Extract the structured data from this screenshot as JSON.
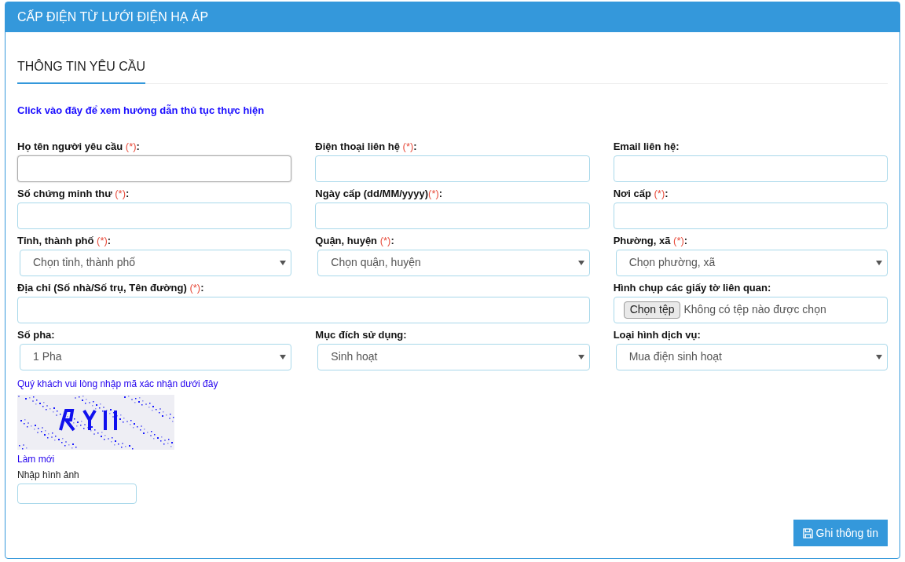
{
  "panel": {
    "title": "CẤP ĐIỆN TỪ LƯỚI ĐIỆN HẠ ÁP"
  },
  "section": {
    "title": "THÔNG TIN YÊU CẦU"
  },
  "guide_link": "Click vào đây để xem hướng dẫn thủ tục thực hiện",
  "fields": [
    {
      "kind": "text",
      "label": "Họ tên người yêu cầu ",
      "required": "(*)",
      "suffix": ":",
      "focused": true
    },
    {
      "kind": "text",
      "label": "Điện thoại liên hệ ",
      "required": "(*)",
      "suffix": ":",
      "focused": false
    },
    {
      "kind": "text",
      "label": "Email liên hệ:",
      "focused": false
    },
    {
      "kind": "text",
      "label": "Số chứng minh thư ",
      "required": "(*)",
      "suffix": ":",
      "focused": false
    },
    {
      "kind": "text",
      "label": "Ngày cấp (dd/MM/yyyy)",
      "required": "(*)",
      "suffix": ":",
      "focused": false
    },
    {
      "kind": "text",
      "label": "Nơi cấp ",
      "required": "(*)",
      "suffix": ":",
      "focused": false
    },
    {
      "kind": "select",
      "label": "Tỉnh, thành phố ",
      "required": "(*)",
      "suffix": ":",
      "value": "Chọn tỉnh, thành phố"
    },
    {
      "kind": "select",
      "label": "Quận, huyện ",
      "required": "(*)",
      "suffix": ":",
      "value": "Chọn quận, huyện"
    },
    {
      "kind": "select",
      "label": "Phường, xã ",
      "required": "(*)",
      "suffix": ":",
      "value": "Chọn phường, xã"
    },
    {
      "kind": "wide_text",
      "label": "Địa chỉ (Số nhà/Số trụ, Tên đường) ",
      "required": "(*)",
      "suffix": ":",
      "focused": false
    },
    {
      "kind": "file",
      "label": "Hình chụp các giấy tờ liên quan:",
      "button": "Chọn tệp",
      "status": "Không có tệp nào được chọn"
    },
    {
      "kind": "select",
      "label": "Số pha:",
      "value": "1 Pha"
    },
    {
      "kind": "select",
      "label": "Mục đích sử dụng:",
      "value": "Sinh hoạt"
    },
    {
      "kind": "select",
      "label": "Loại hình dịch vụ:",
      "value": "Mua điện sinh hoạt"
    }
  ],
  "captcha": {
    "prompt": "Quý khách vui lòng nhập mã xác nhận dưới đây",
    "refresh": "Làm mới",
    "input_label": "Nhập hình ảnh"
  },
  "save_button": "Ghi thông tin"
}
